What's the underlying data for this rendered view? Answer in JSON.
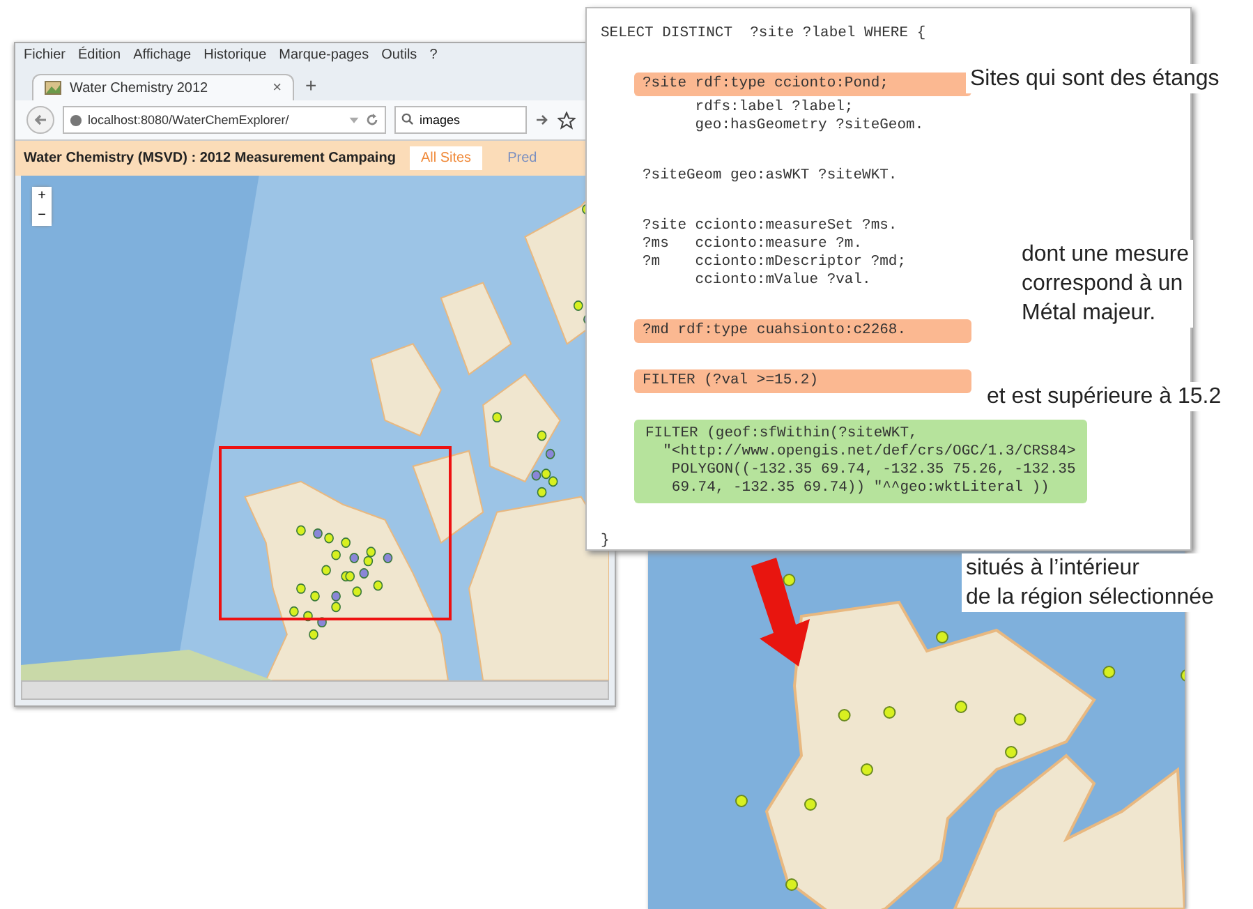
{
  "browser": {
    "menu": [
      "Fichier",
      "Édition",
      "Affichage",
      "Historique",
      "Marque-pages",
      "Outils",
      "?"
    ],
    "tab": {
      "title": "Water Chemistry 2012",
      "close": "×"
    },
    "new_tab": "+",
    "url": "localhost:8080/WaterChemExplorer/",
    "search": {
      "value": "images"
    },
    "app_title": "Water Chemistry (MSVD) : 2012 Measurement Campaing",
    "app_tabs": [
      {
        "label": "All Sites",
        "selected": true
      },
      {
        "label": "Pred",
        "selected": false
      }
    ],
    "zoom_in": "+",
    "zoom_out": "−"
  },
  "query": {
    "blocks": [
      {
        "kind": "start",
        "lines": [
          "SELECT DISTINCT  ?site ?label WHERE {"
        ]
      },
      {
        "kind": "indented",
        "color": "#fbb891",
        "lines": [
          "?site rdf:type ccionto:Pond;"
        ]
      },
      {
        "kind": "continuation",
        "lines": [
          "      rdfs:label ?label;",
          "      geo:hasGeometry ?siteGeom."
        ]
      },
      {
        "kind": "indented",
        "lines": [
          "?siteGeom geo:asWKT ?siteWKT."
        ]
      },
      {
        "kind": "indented",
        "lines": [
          "?site ccionto:measureSet ?ms.",
          "?ms   ccionto:measure ?m.",
          "?m    ccionto:mDescriptor ?md;",
          "      ccionto:mValue ?val."
        ]
      },
      {
        "kind": "indented",
        "color": "#fbb891",
        "lines": [
          "?md rdf:type cuahsionto:c2268."
        ]
      },
      {
        "kind": "indented",
        "color": "#fbb891",
        "lines": [
          "FILTER (?val >=15.2)"
        ]
      },
      {
        "kind": "indented",
        "color": "#b6e39c",
        "lines": [
          "FILTER (geof:sfWithin(?siteWKT,",
          "  \"<http://www.opengis.net/def/crs/OGC/1.3/CRS84>",
          "   POLYGON((-132.35 69.74, -132.35 75.26, -132.35",
          "   69.74, -132.35 69.74)) \"^^geo:wktLiteral ))"
        ]
      },
      {
        "kind": "start",
        "lines": [
          "}"
        ]
      }
    ]
  },
  "annotations": [
    {
      "lines": [
        "Sites qui sont des étangs"
      ]
    },
    {
      "lines": [
        "dont une mesure",
        "correspond à un",
        "Métal majeur."
      ]
    },
    {
      "lines": [
        "et est supérieure à 15.2"
      ]
    },
    {
      "lines": [
        "situés à l’intérieur",
        "de la région sélectionnée"
      ]
    }
  ]
}
